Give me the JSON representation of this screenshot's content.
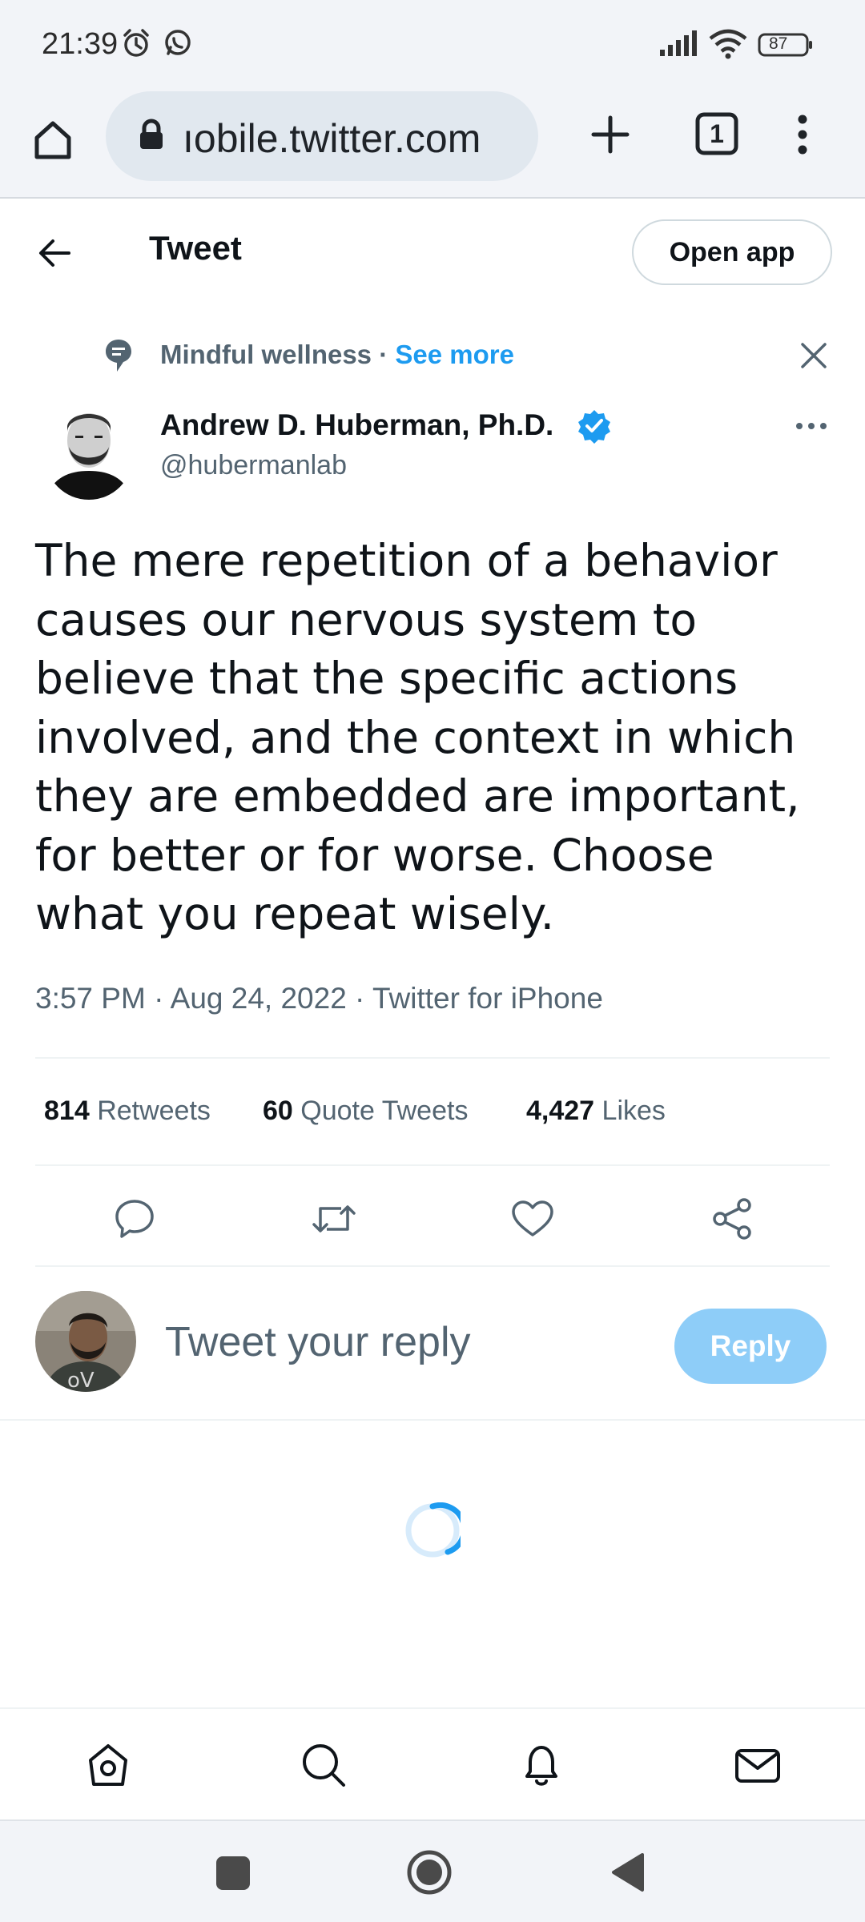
{
  "status_bar": {
    "time": "21:39",
    "battery": "87",
    "icons": [
      "alarm-icon",
      "whatsapp-icon",
      "signal-icon",
      "wifi-icon",
      "battery-icon"
    ]
  },
  "browser": {
    "url": "ıobile.twitter.com",
    "tab_count": "1",
    "icons": [
      "home-icon",
      "lock-icon",
      "new-tab-icon",
      "tab-switcher-icon",
      "more-vert-icon"
    ]
  },
  "header": {
    "title": "Tweet",
    "open_app_label": "Open app"
  },
  "topic": {
    "name": "Mindful wellness",
    "separator": " · ",
    "see_more": "See more"
  },
  "author": {
    "name": "Andrew D. Huberman, Ph.D.",
    "handle": "@hubermanlab",
    "verified": true
  },
  "tweet": {
    "text": "The mere repetition of a behavior causes our nervous system to believe that the specific actions involved, and the context in which they are embedded are important, for better or for worse. Choose what you repeat wisely.",
    "time": "3:57 PM",
    "date": "Aug 24, 2022",
    "source": "Twitter for iPhone",
    "meta_separator": " · "
  },
  "stats": {
    "retweets_count": "814",
    "retweets_label": "Retweets",
    "quotes_count": "60",
    "quotes_label": "Quote Tweets",
    "likes_count": "4,427",
    "likes_label": "Likes"
  },
  "reply": {
    "placeholder": "Tweet your reply",
    "button_label": "Reply"
  },
  "colors": {
    "accent": "#1d9bf0",
    "reply_button_disabled": "#8ecdf8",
    "secondary_text": "#536471"
  }
}
